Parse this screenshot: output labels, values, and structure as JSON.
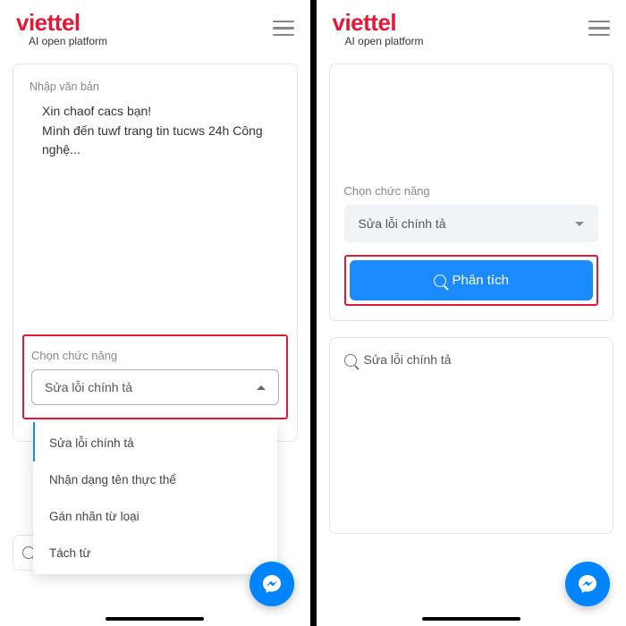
{
  "brand": {
    "name": "viettel",
    "tagline": "AI open platform"
  },
  "left": {
    "input_label": "Nhập văn bản",
    "input_text": "Xin chaof cacs bạn!\nMình đến tuwf trang tin tucws 24h Công nghệ...",
    "select_label": "Chọn chức năng",
    "selected": "Sửa lỗi chính tả",
    "options": [
      "Sửa lỗi chính tả",
      "Nhận dạng tên thực thể",
      "Gán nhãn từ loại",
      "Tách từ"
    ]
  },
  "right": {
    "select_label": "Chọn chức năng",
    "selected": "Sửa lỗi chính tả",
    "analyze": "Phân tích",
    "result_title": "Sửa lỗi chính tả"
  }
}
